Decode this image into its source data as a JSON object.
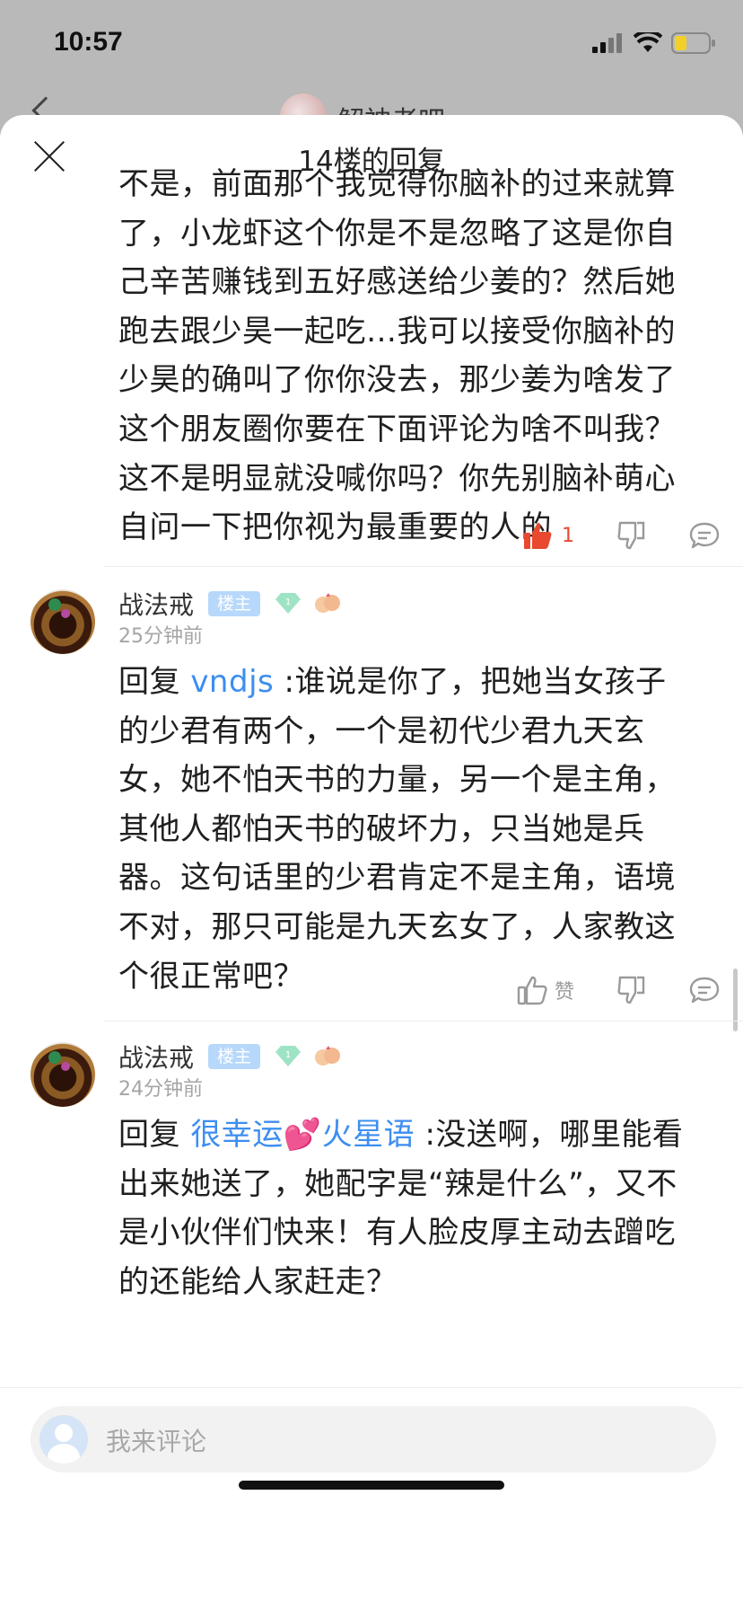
{
  "status_bar": {
    "time": "10:57"
  },
  "background_header": {
    "title": "解神者吧"
  },
  "sheet": {
    "title": "14楼的回复",
    "input_placeholder": "我来评论"
  },
  "main_post": {
    "lines": [
      "不是，前面那个我觉得你脑补的过来就算",
      "了，小龙虾这个你是不是忽略了这是你自",
      "己辛苦赚钱到五好感送给少姜的？然后她",
      "跑去跟少昊一起吃…我可以接受你脑补的",
      "少昊的确叫了你你没去，那少姜为啥发了",
      "这个朋友圈你要在下面评论为啥不叫我？",
      "这不是明显就没喊你吗？你先别脑补萌心",
      "自问一下把你视为最重要的人的"
    ],
    "like_count": "1"
  },
  "comments": [
    {
      "author": "战法戒",
      "badge": "楼主",
      "timestamp": "25分钟前",
      "reply_prefix": "回复 ",
      "reply_to": "vndjs",
      "first_line_rest": " :谁说是你了，把她当女孩子",
      "lines": [
        "的少君有两个，一个是初代少君九天玄",
        "女，她不怕天书的力量，另一个是主角，",
        "其他人都怕天书的破坏力，只当她是兵",
        "器。这句话里的少君肯定不是主角，语境",
        "不对，那只可能是九天玄女了，人家教这",
        "个很正常吧？"
      ],
      "like_label": "赞"
    },
    {
      "author": "战法戒",
      "badge": "楼主",
      "timestamp": "24分钟前",
      "reply_prefix": "回复 ",
      "reply_to": "很幸运💕火星语",
      "first_line_rest": " :没送啊，哪里能看",
      "lines": [
        "出来她送了，她配字是“辣是什么”，又不",
        "是小伙伴们快来！有人脸皮厚主动去蹭吃",
        "的还能给人家赶走？"
      ]
    }
  ],
  "colors": {
    "accent_blue": "#3d8ef0",
    "like_red": "#e8492f",
    "badge_blue": "#b7d8fb"
  }
}
